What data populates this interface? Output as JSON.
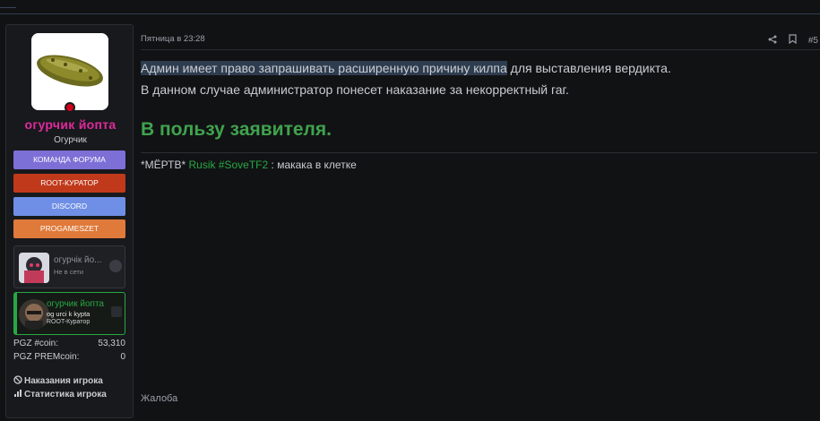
{
  "user": {
    "name": "огурчик йопта",
    "title": "Огурчик",
    "avatar_icon": "pickle-avatar",
    "badges": [
      {
        "label": "КОМАНДА ФОРУМА",
        "color": "#7c6fd6"
      },
      {
        "label": "ROOT-КУРАТОР",
        "color": "#c0391b"
      },
      {
        "label": "DISCORD",
        "color": "#6f8fe6"
      },
      {
        "label": "PROGAMESZET",
        "color": "#e07a3a"
      }
    ],
    "cards": [
      {
        "name": "огурчік йо...",
        "status": "Не в сети"
      },
      {
        "name": "огурчик йопта",
        "sub": "og urci k kypta",
        "role": "ROOT-Куратор"
      }
    ],
    "stats": [
      {
        "label": "PGZ #coin:",
        "value": "53,310"
      },
      {
        "label": "PGZ PREMcoin:",
        "value": "0"
      }
    ],
    "links": [
      {
        "label": "Наказания игрока",
        "icon": "ban-icon"
      },
      {
        "label": "Статистика игрока",
        "icon": "chart-icon"
      }
    ]
  },
  "post": {
    "date": "Пятница в 23:28",
    "number": "#5",
    "line1_highlight": "Админ имеет право запрашивать расширенную причину килпа",
    "line1_rest": " для выставления вердикта.",
    "line2": "В данном случае администратор понесет наказание за некорректный гаг.",
    "verdict": "В пользу заявителя.",
    "signature": {
      "part1": "*МЁРТВ* ",
      "part2": "Rusik #SoveTF2",
      "part3": " : макака в клетке"
    },
    "report_label": "Жалоба"
  },
  "colors": {
    "background": "#111214",
    "username": "#e02a9c",
    "verdict": "#3fa34d",
    "highlight": "#2e3c4f",
    "green_accent": "#27a844"
  }
}
